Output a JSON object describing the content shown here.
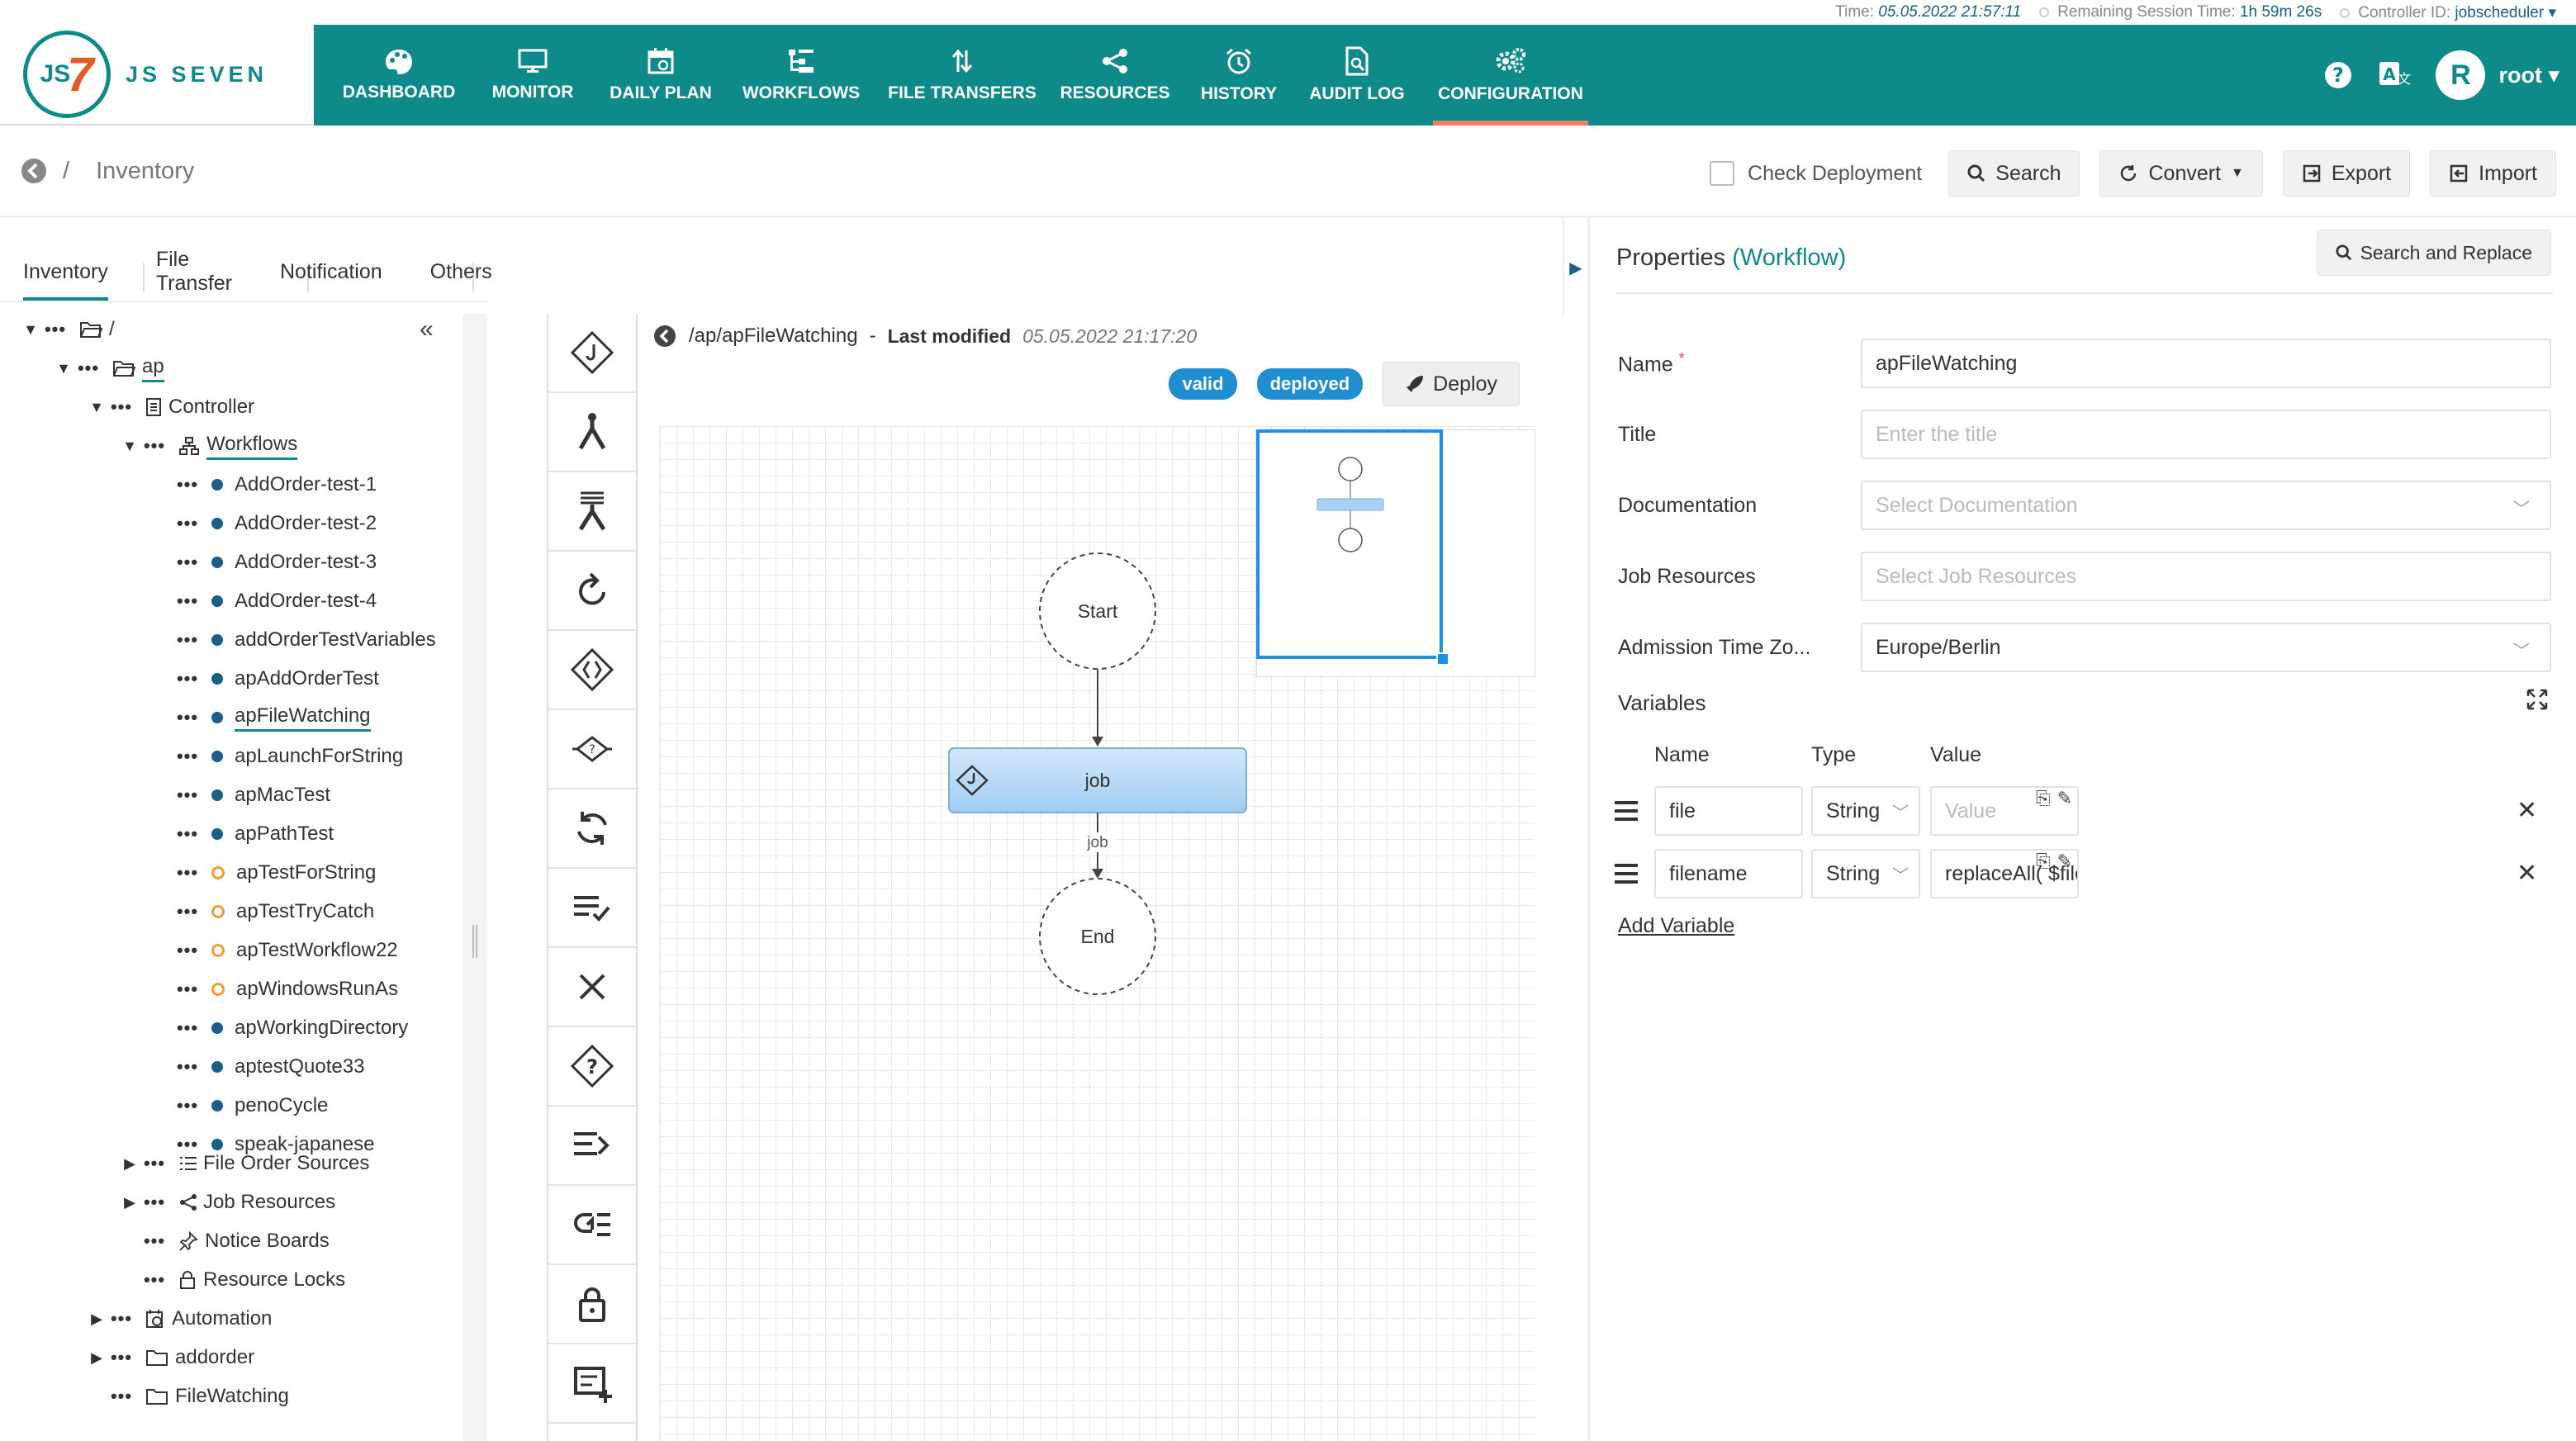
{
  "topinfo": {
    "time_label": "Time:",
    "time_value": "05.05.2022 21:57:11",
    "session_label": "Remaining Session Time:",
    "session_value": "1h 59m 26s",
    "controller_label": "Controller ID:",
    "controller_value": "jobscheduler"
  },
  "logo": {
    "mark": "JS",
    "seven": "7",
    "brand": "JS SEVEN"
  },
  "nav": {
    "items": [
      {
        "label": "DASHBOARD",
        "icon": "palette-icon"
      },
      {
        "label": "MONITOR",
        "icon": "monitor-icon"
      },
      {
        "label": "DAILY PLAN",
        "icon": "calendar-icon"
      },
      {
        "label": "WORKFLOWS",
        "icon": "workflows-icon"
      },
      {
        "label": "FILE TRANSFERS",
        "icon": "transfer-icon"
      },
      {
        "label": "RESOURCES",
        "icon": "share-icon"
      },
      {
        "label": "HISTORY",
        "icon": "alarm-icon"
      },
      {
        "label": "AUDIT LOG",
        "icon": "audit-icon"
      },
      {
        "label": "CONFIGURATION",
        "icon": "gear-icon"
      }
    ],
    "active": "CONFIGURATION",
    "avatar_letter": "R",
    "user": "root"
  },
  "breadcrumb": {
    "sep": "/",
    "current": "Inventory"
  },
  "toolbar": {
    "check_deployment": "Check Deployment",
    "search": "Search",
    "convert": "Convert",
    "export": "Export",
    "import": "Import"
  },
  "tabs": [
    "Inventory",
    "File Transfer",
    "Notification",
    "Others"
  ],
  "tree": {
    "root": "/",
    "ap": "ap",
    "controller": "Controller",
    "workflows": "Workflows",
    "workflow_items": [
      {
        "label": "AddOrder-test-1",
        "status": "blue"
      },
      {
        "label": "AddOrder-test-2",
        "status": "blue"
      },
      {
        "label": "AddOrder-test-3",
        "status": "blue"
      },
      {
        "label": "AddOrder-test-4",
        "status": "blue"
      },
      {
        "label": "addOrderTestVariables",
        "status": "blue"
      },
      {
        "label": "apAddOrderTest",
        "status": "blue"
      },
      {
        "label": "apFileWatching",
        "status": "blue"
      },
      {
        "label": "apLaunchForString",
        "status": "blue"
      },
      {
        "label": "apMacTest",
        "status": "blue"
      },
      {
        "label": "apPathTest",
        "status": "blue"
      },
      {
        "label": "apTestForString",
        "status": "orange"
      },
      {
        "label": "apTestTryCatch",
        "status": "orange"
      },
      {
        "label": "apTestWorkflow22",
        "status": "orange"
      },
      {
        "label": "apWindowsRunAs",
        "status": "orange"
      },
      {
        "label": "apWorkingDirectory",
        "status": "blue"
      },
      {
        "label": "aptestQuote33",
        "status": "blue"
      },
      {
        "label": "penoCycle",
        "status": "blue"
      },
      {
        "label": "speak-japanese",
        "status": "blue"
      }
    ],
    "selected": "apFileWatching",
    "file_order_sources": "File Order Sources",
    "job_resources": "Job Resources",
    "notice_boards": "Notice Boards",
    "resource_locks": "Resource Locks",
    "automation": "Automation",
    "addorder": "addorder",
    "filewatching": "FileWatching"
  },
  "editor": {
    "path": "/ap/apFileWatching",
    "dash": "-",
    "last_modified_label": "Last modified",
    "last_modified_value": "05.05.2022 21:17:20",
    "badge_valid": "valid",
    "badge_deployed": "deployed",
    "deploy": "Deploy",
    "node_start": "Start",
    "node_job": "job",
    "edge_label": "job",
    "node_end": "End"
  },
  "properties": {
    "title": "Properties",
    "type": "(Workflow)",
    "search_replace": "Search and Replace",
    "name_label": "Name",
    "name_required": "*",
    "name_value": "apFileWatching",
    "title_label": "Title",
    "title_placeholder": "Enter the title",
    "documentation_label": "Documentation",
    "documentation_placeholder": "Select Documentation",
    "job_resources_label": "Job Resources",
    "job_resources_placeholder": "Select Job Resources",
    "timezone_label": "Admission Time Zo...",
    "timezone_value": "Europe/Berlin",
    "variables_label": "Variables",
    "col_name": "Name",
    "col_type": "Type",
    "col_value": "Value",
    "variables": [
      {
        "name": "file",
        "type": "String",
        "value": "",
        "placeholder": "Value"
      },
      {
        "name": "filename",
        "type": "String",
        "value": "replaceAll( $file, '^.*[/\\\\](",
        "placeholder": ""
      }
    ],
    "add_variable": "Add Variable"
  }
}
